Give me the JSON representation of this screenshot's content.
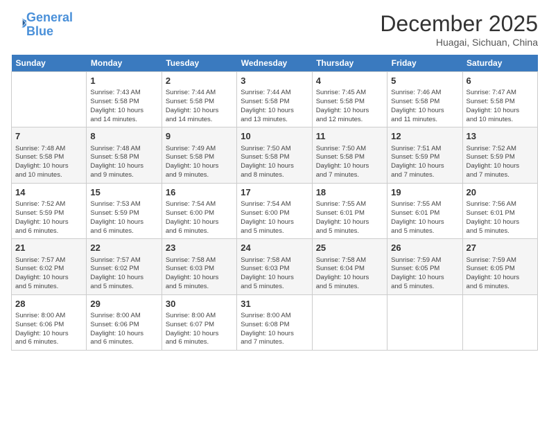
{
  "logo": {
    "line1": "General",
    "line2": "Blue"
  },
  "title": "December 2025",
  "subtitle": "Huagai, Sichuan, China",
  "days_of_week": [
    "Sunday",
    "Monday",
    "Tuesday",
    "Wednesday",
    "Thursday",
    "Friday",
    "Saturday"
  ],
  "weeks": [
    [
      {
        "day": "",
        "info": ""
      },
      {
        "day": "1",
        "info": "Sunrise: 7:43 AM\nSunset: 5:58 PM\nDaylight: 10 hours\nand 14 minutes."
      },
      {
        "day": "2",
        "info": "Sunrise: 7:44 AM\nSunset: 5:58 PM\nDaylight: 10 hours\nand 14 minutes."
      },
      {
        "day": "3",
        "info": "Sunrise: 7:44 AM\nSunset: 5:58 PM\nDaylight: 10 hours\nand 13 minutes."
      },
      {
        "day": "4",
        "info": "Sunrise: 7:45 AM\nSunset: 5:58 PM\nDaylight: 10 hours\nand 12 minutes."
      },
      {
        "day": "5",
        "info": "Sunrise: 7:46 AM\nSunset: 5:58 PM\nDaylight: 10 hours\nand 11 minutes."
      },
      {
        "day": "6",
        "info": "Sunrise: 7:47 AM\nSunset: 5:58 PM\nDaylight: 10 hours\nand 10 minutes."
      }
    ],
    [
      {
        "day": "7",
        "info": "Sunrise: 7:48 AM\nSunset: 5:58 PM\nDaylight: 10 hours\nand 10 minutes."
      },
      {
        "day": "8",
        "info": "Sunrise: 7:48 AM\nSunset: 5:58 PM\nDaylight: 10 hours\nand 9 minutes."
      },
      {
        "day": "9",
        "info": "Sunrise: 7:49 AM\nSunset: 5:58 PM\nDaylight: 10 hours\nand 9 minutes."
      },
      {
        "day": "10",
        "info": "Sunrise: 7:50 AM\nSunset: 5:58 PM\nDaylight: 10 hours\nand 8 minutes."
      },
      {
        "day": "11",
        "info": "Sunrise: 7:50 AM\nSunset: 5:58 PM\nDaylight: 10 hours\nand 7 minutes."
      },
      {
        "day": "12",
        "info": "Sunrise: 7:51 AM\nSunset: 5:59 PM\nDaylight: 10 hours\nand 7 minutes."
      },
      {
        "day": "13",
        "info": "Sunrise: 7:52 AM\nSunset: 5:59 PM\nDaylight: 10 hours\nand 7 minutes."
      }
    ],
    [
      {
        "day": "14",
        "info": "Sunrise: 7:52 AM\nSunset: 5:59 PM\nDaylight: 10 hours\nand 6 minutes."
      },
      {
        "day": "15",
        "info": "Sunrise: 7:53 AM\nSunset: 5:59 PM\nDaylight: 10 hours\nand 6 minutes."
      },
      {
        "day": "16",
        "info": "Sunrise: 7:54 AM\nSunset: 6:00 PM\nDaylight: 10 hours\nand 6 minutes."
      },
      {
        "day": "17",
        "info": "Sunrise: 7:54 AM\nSunset: 6:00 PM\nDaylight: 10 hours\nand 5 minutes."
      },
      {
        "day": "18",
        "info": "Sunrise: 7:55 AM\nSunset: 6:01 PM\nDaylight: 10 hours\nand 5 minutes."
      },
      {
        "day": "19",
        "info": "Sunrise: 7:55 AM\nSunset: 6:01 PM\nDaylight: 10 hours\nand 5 minutes."
      },
      {
        "day": "20",
        "info": "Sunrise: 7:56 AM\nSunset: 6:01 PM\nDaylight: 10 hours\nand 5 minutes."
      }
    ],
    [
      {
        "day": "21",
        "info": "Sunrise: 7:57 AM\nSunset: 6:02 PM\nDaylight: 10 hours\nand 5 minutes."
      },
      {
        "day": "22",
        "info": "Sunrise: 7:57 AM\nSunset: 6:02 PM\nDaylight: 10 hours\nand 5 minutes."
      },
      {
        "day": "23",
        "info": "Sunrise: 7:58 AM\nSunset: 6:03 PM\nDaylight: 10 hours\nand 5 minutes."
      },
      {
        "day": "24",
        "info": "Sunrise: 7:58 AM\nSunset: 6:03 PM\nDaylight: 10 hours\nand 5 minutes."
      },
      {
        "day": "25",
        "info": "Sunrise: 7:58 AM\nSunset: 6:04 PM\nDaylight: 10 hours\nand 5 minutes."
      },
      {
        "day": "26",
        "info": "Sunrise: 7:59 AM\nSunset: 6:05 PM\nDaylight: 10 hours\nand 5 minutes."
      },
      {
        "day": "27",
        "info": "Sunrise: 7:59 AM\nSunset: 6:05 PM\nDaylight: 10 hours\nand 6 minutes."
      }
    ],
    [
      {
        "day": "28",
        "info": "Sunrise: 8:00 AM\nSunset: 6:06 PM\nDaylight: 10 hours\nand 6 minutes."
      },
      {
        "day": "29",
        "info": "Sunrise: 8:00 AM\nSunset: 6:06 PM\nDaylight: 10 hours\nand 6 minutes."
      },
      {
        "day": "30",
        "info": "Sunrise: 8:00 AM\nSunset: 6:07 PM\nDaylight: 10 hours\nand 6 minutes."
      },
      {
        "day": "31",
        "info": "Sunrise: 8:00 AM\nSunset: 6:08 PM\nDaylight: 10 hours\nand 7 minutes."
      },
      {
        "day": "",
        "info": ""
      },
      {
        "day": "",
        "info": ""
      },
      {
        "day": "",
        "info": ""
      }
    ]
  ]
}
